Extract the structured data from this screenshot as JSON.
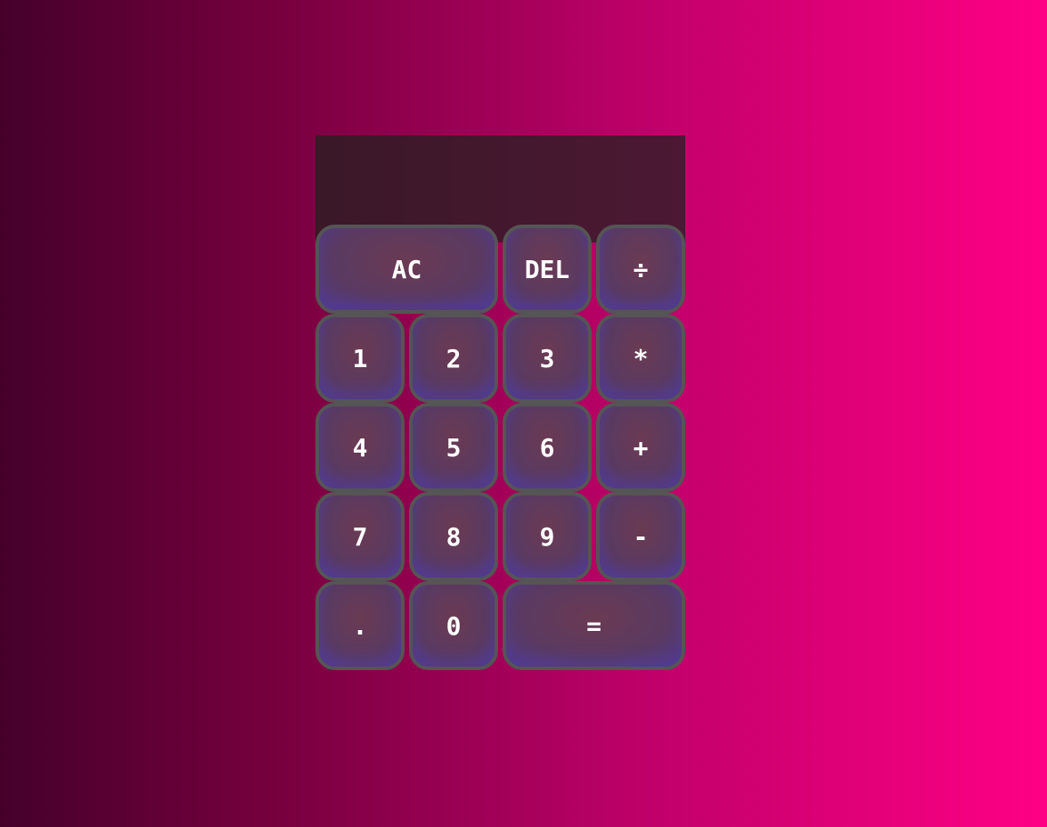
{
  "display": {
    "previous_operand": "",
    "current_operand": ""
  },
  "buttons": {
    "all_clear": "AC",
    "delete": "DEL",
    "divide": "÷",
    "one": "1",
    "two": "2",
    "three": "3",
    "multiply": "*",
    "four": "4",
    "five": "5",
    "six": "6",
    "add": "+",
    "seven": "7",
    "eight": "8",
    "nine": "9",
    "subtract": "-",
    "decimal": ".",
    "zero": "0",
    "equals": "="
  },
  "colors": {
    "background_start": "#45002a",
    "background_end": "#ff0084",
    "display_background": "#3a1828",
    "button_border": "#555555",
    "button_text": "#ffffff"
  }
}
